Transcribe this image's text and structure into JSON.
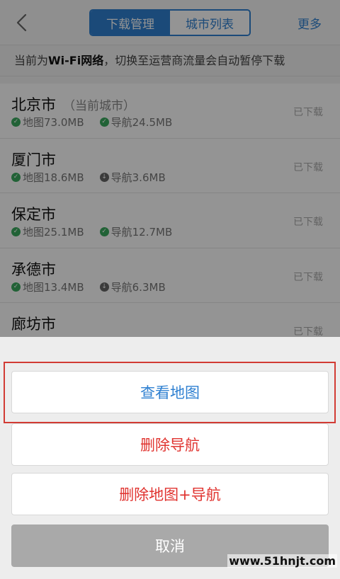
{
  "nav": {
    "tabs": [
      {
        "label": "下载管理",
        "active": true
      },
      {
        "label": "城市列表",
        "active": false
      }
    ],
    "more_label": "更多"
  },
  "notice": {
    "prefix": "当前为",
    "network": "Wi-Fi网络",
    "suffix": "，切换至运营商流量会自动暂停下载"
  },
  "cities": [
    {
      "name": "北京市",
      "current_label": "（当前城市）",
      "map": "地图73.0MB",
      "map_icon": "check-icon",
      "nav": "导航24.5MB",
      "nav_icon": "check-icon",
      "status": "已下载"
    },
    {
      "name": "厦门市",
      "current_label": "",
      "map": "地图18.6MB",
      "map_icon": "check-icon",
      "nav": "导航3.6MB",
      "nav_icon": "download-icon",
      "status": "已下载"
    },
    {
      "name": "保定市",
      "current_label": "",
      "map": "地图25.1MB",
      "map_icon": "check-icon",
      "nav": "导航12.7MB",
      "nav_icon": "check-icon",
      "status": "已下载"
    },
    {
      "name": "承德市",
      "current_label": "",
      "map": "地图13.4MB",
      "map_icon": "check-icon",
      "nav": "导航6.3MB",
      "nav_icon": "download-icon",
      "status": "已下载"
    },
    {
      "name": "廊坊市",
      "current_label": "",
      "map": "",
      "map_icon": "check-icon",
      "nav": "",
      "nav_icon": "check-icon",
      "status": "已下载"
    }
  ],
  "sheet": {
    "view_map": "查看地图",
    "delete_nav": "删除导航",
    "delete_map_nav": "删除地图+导航",
    "cancel": "取消"
  },
  "watermark": "www.51hnjt.com",
  "colors": {
    "accent": "#2f80d1",
    "danger": "#e0332f",
    "success": "#3aa95e",
    "highlight_border": "#d23b34"
  }
}
